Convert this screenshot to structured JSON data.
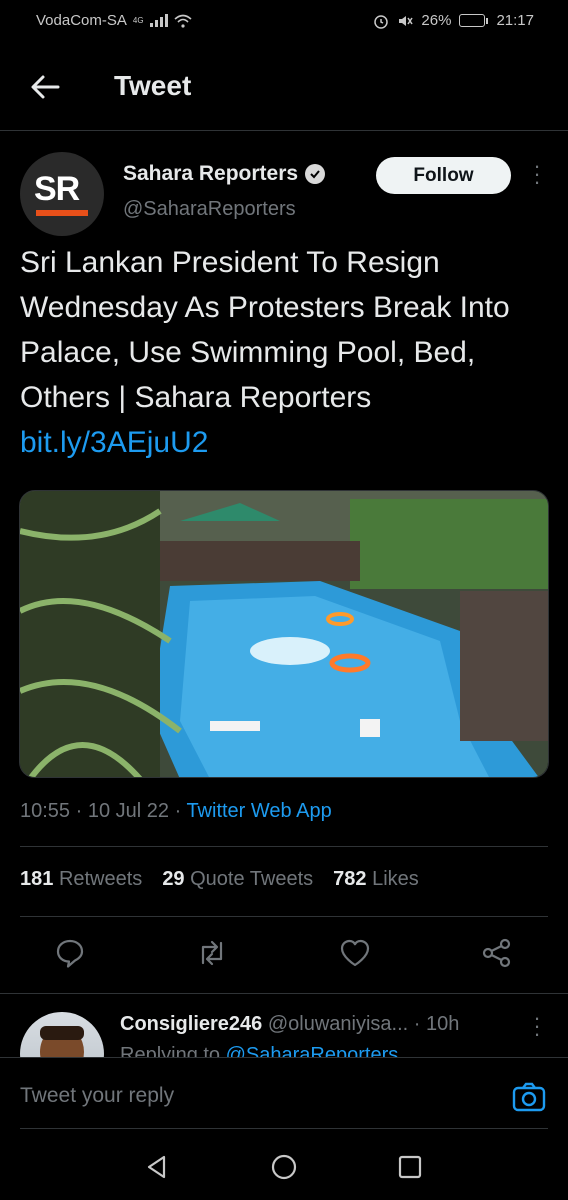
{
  "status_bar": {
    "carrier": "VodaCom-SA",
    "network": "4G",
    "battery": "26%",
    "battery_level": 0.26,
    "time": "21:17"
  },
  "header": {
    "title": "Tweet"
  },
  "tweet": {
    "author_name": "Sahara Reporters",
    "author_handle": "@SaharaReporters",
    "avatar_text": "SR",
    "follow_label": "Follow",
    "text": "Sri Lankan President To Resign Wednesday As Protesters Break Into Palace, Use Swimming Pool, Bed, Others | Sahara Reporters",
    "link": "bit.ly/3AEjuU2",
    "time": "10:55",
    "date": "10 Jul 22",
    "source": "Twitter Web App",
    "retweets_count": "181",
    "retweets_label": "Retweets",
    "quotes_count": "29",
    "quotes_label": "Quote Tweets",
    "likes_count": "782",
    "likes_label": "Likes"
  },
  "reply_preview": {
    "name": "Consigliere246",
    "handle": "@oluwaniyisa...",
    "age": "· 10h",
    "replying_prefix": "Replying to",
    "replying_to": "@SaharaReporters"
  },
  "compose": {
    "placeholder": "Tweet your reply"
  },
  "icons": {
    "back": "arrow-left-icon",
    "verified": "verified-badge-icon",
    "more": "more-vertical-icon",
    "reply": "comment-icon",
    "retweet": "retweet-icon",
    "like": "heart-icon",
    "share": "share-icon",
    "camera": "camera-icon",
    "nav_back": "triangle-back-icon",
    "nav_home": "circle-home-icon",
    "nav_recents": "square-recents-icon"
  },
  "colors": {
    "background": "#000000",
    "link": "#1d9bf0",
    "muted": "#71767b",
    "brand_accent": "#e8501a"
  }
}
